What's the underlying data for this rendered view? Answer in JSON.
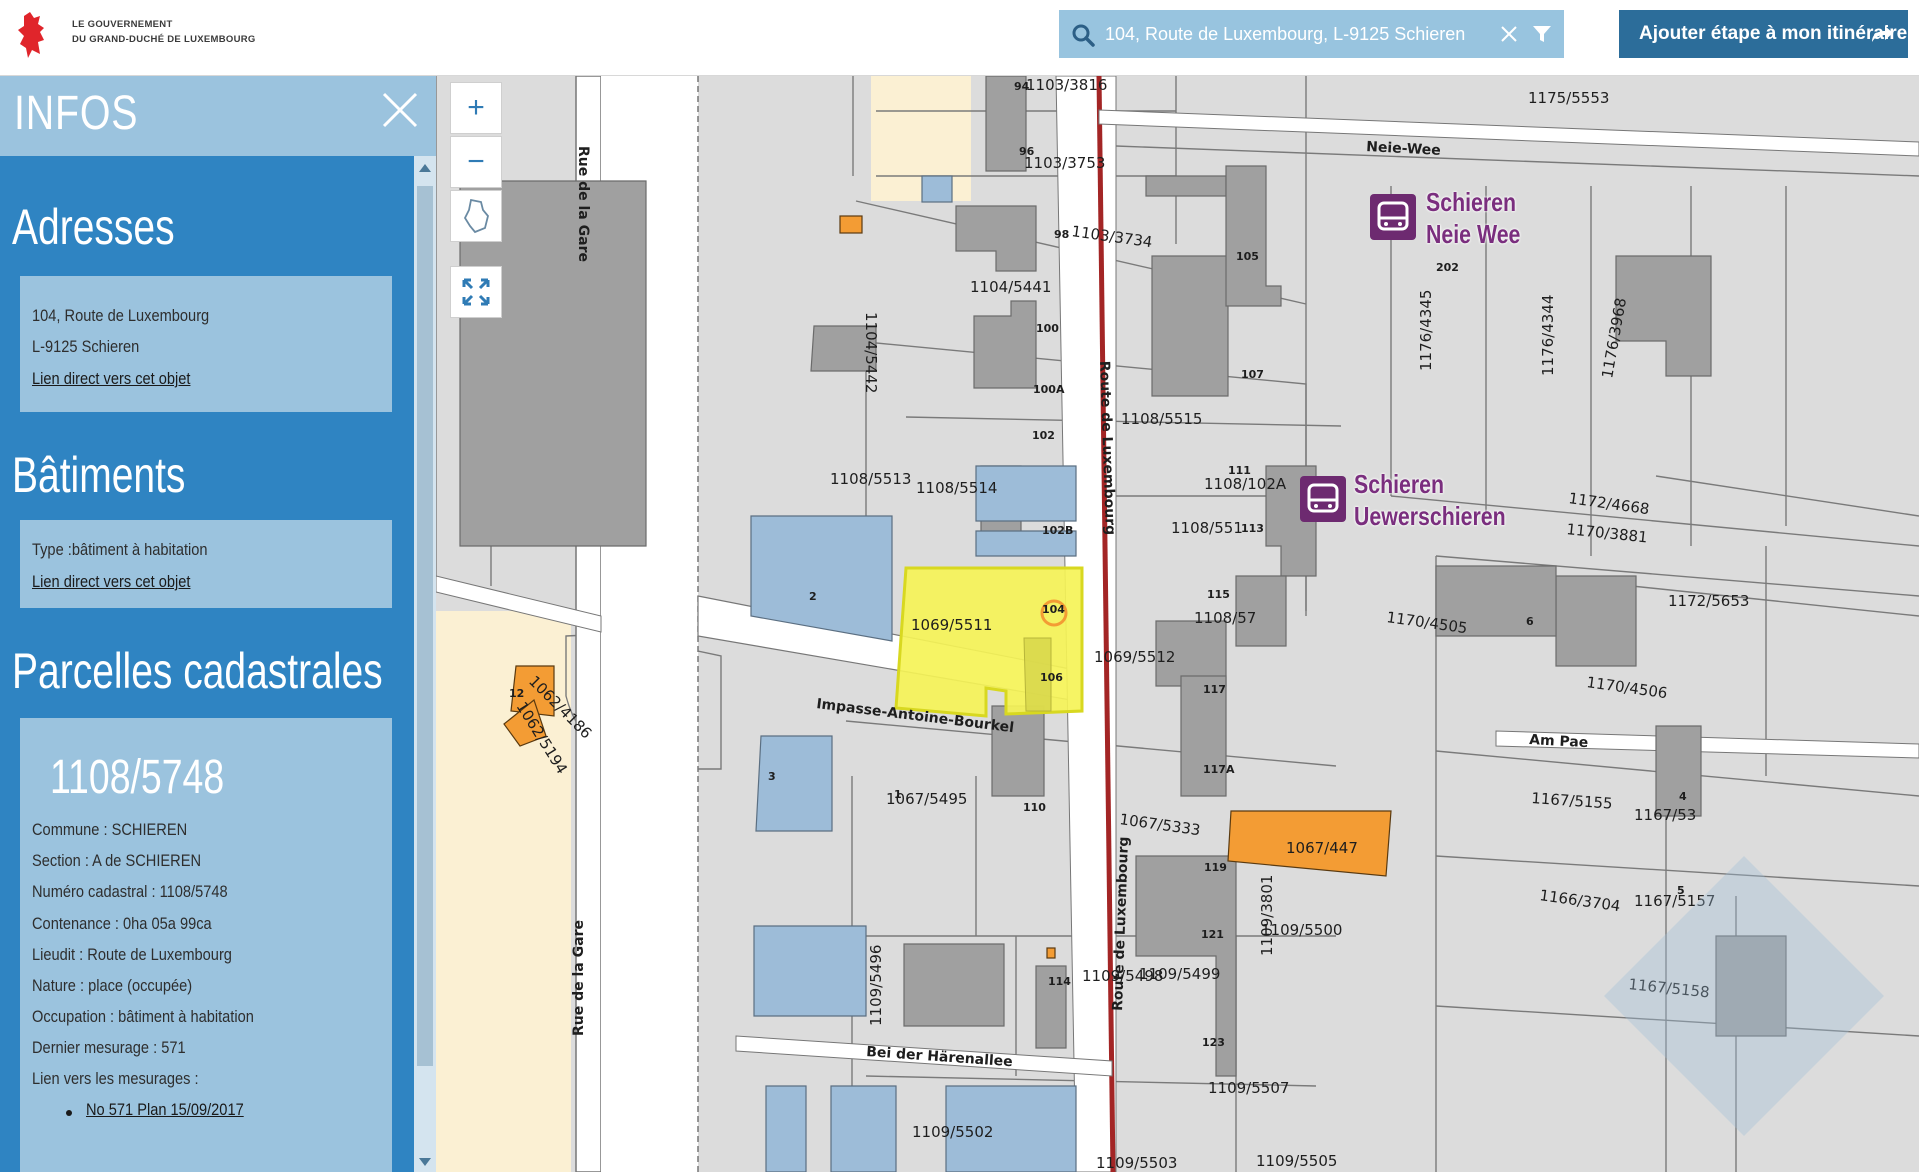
{
  "header": {
    "logo_line1": "Le Gouvernement",
    "logo_line2": "du Grand-Duché de Luxembourg",
    "search_value": "104, Route de Luxembourg, L-9125 Schieren",
    "itinerary_button": "Ajouter étape à mon itinéraire"
  },
  "sidebar": {
    "title": "INFOS",
    "adresses": {
      "heading": "Adresses",
      "line1": "104, Route de Luxembourg",
      "line2": "L-9125 Schieren",
      "link": "Lien direct vers cet objet"
    },
    "batiments": {
      "heading": "Bâtiments",
      "type": "Type :bâtiment à habitation",
      "link": "Lien direct vers cet objet"
    },
    "parcelles": {
      "heading": "Parcelles cadastrales",
      "number": "1108/5748",
      "commune": "Commune : SCHIEREN",
      "section": "Section : A de SCHIEREN",
      "numero": "Numéro cadastral : 1108/5748",
      "contenance": "Contenance : 0ha 05a 99ca",
      "lieudit": "Lieudit : Route de Luxembourg",
      "nature": "Nature : place (occupée)",
      "occupation": "Occupation : bâtiment à habitation",
      "mesurage": "Dernier mesurage : 571",
      "lien_mesurages": "Lien vers les mesurages :",
      "mesurage_link": "No 571 Plan 15/09/2017"
    }
  },
  "map_controls": {
    "zoom_in": "+",
    "zoom_out": "−"
  },
  "map": {
    "colors": {
      "parcel": "#dcdcdc",
      "building": "#9f9f9f",
      "selected": "#f5f357",
      "blue": "#9dbcd8",
      "orange": "#f39c34",
      "road": "#ffffff",
      "main_road": "#a32525",
      "sand": "#fbf0d3",
      "bus": "#6d2a70"
    },
    "bus_stops": [
      {
        "name": "Schieren\nNeie Wee"
      },
      {
        "name": "Schieren\nUewerschieren"
      }
    ],
    "streets": [
      "Rue de la Gare",
      "Rue de la Gare",
      "Route de Luxembourg",
      "Route de Luxembourg",
      "Neie-Wee",
      "Impasse-Antoine-Bourkel",
      "Bei der Härenallee",
      "Am Pae"
    ],
    "labels": [
      "1103/3816",
      "1103/3753",
      "1103/3734",
      "1104/5441",
      "1104/5442",
      "1108/5515",
      "1108/5513",
      "1108/5514",
      "1108/102A",
      "1108/551",
      "1108/57",
      "1069/5511",
      "1069/5512",
      "1062/4186",
      "1062/5194",
      "1067/5495",
      "1067/5333",
      "1067/447",
      "1109/5500",
      "1109/5499",
      "1109/3801",
      "1109/5496",
      "1109/5498",
      "1109/5502",
      "1109/5503",
      "1109/5505",
      "1109/5507",
      "1175/5553",
      "1176/4345",
      "1176/4344",
      "1176/3968",
      "1172/4668",
      "1170/3881",
      "1170/4505",
      "1170/4506",
      "1172/5653",
      "1167/5155",
      "1167/53",
      "1167/5157",
      "1167/5158",
      "1166/3704",
      "202",
      "94",
      "96",
      "98",
      "100",
      "100A",
      "102",
      "102B",
      "104",
      "106",
      "105",
      "107",
      "111",
      "113",
      "115",
      "117",
      "117A",
      "119",
      "121",
      "123",
      "110",
      "114",
      "1",
      "2",
      "3",
      "4",
      "5",
      "6",
      "10",
      "12"
    ]
  }
}
